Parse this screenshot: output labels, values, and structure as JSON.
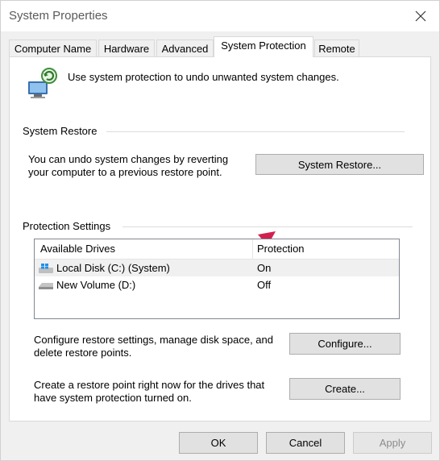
{
  "window": {
    "title": "System Properties"
  },
  "tabs": [
    {
      "label": "Computer Name"
    },
    {
      "label": "Hardware"
    },
    {
      "label": "Advanced"
    },
    {
      "label": "System Protection",
      "active": true
    },
    {
      "label": "Remote"
    }
  ],
  "intro": {
    "text": "Use system protection to undo unwanted system changes."
  },
  "system_restore": {
    "group_label": "System Restore",
    "description": "You can undo system changes by reverting your computer to a previous restore point.",
    "button_label": "System Restore..."
  },
  "protection": {
    "group_label": "Protection Settings",
    "columns": [
      "Available Drives",
      "Protection"
    ],
    "drives": [
      {
        "name": "Local Disk (C:) (System)",
        "protection": "On",
        "selected": true
      },
      {
        "name": "New Volume (D:)",
        "protection": "Off"
      }
    ],
    "configure_text": "Configure restore settings, manage disk space, and delete restore points.",
    "configure_button": "Configure...",
    "create_text": "Create a restore point right now for the drives that have system protection turned on.",
    "create_button": "Create..."
  },
  "footer": {
    "ok": "OK",
    "cancel": "Cancel",
    "apply": "Apply"
  },
  "colors": {
    "arrow": "#d0214e",
    "accent": "#0078d7"
  }
}
